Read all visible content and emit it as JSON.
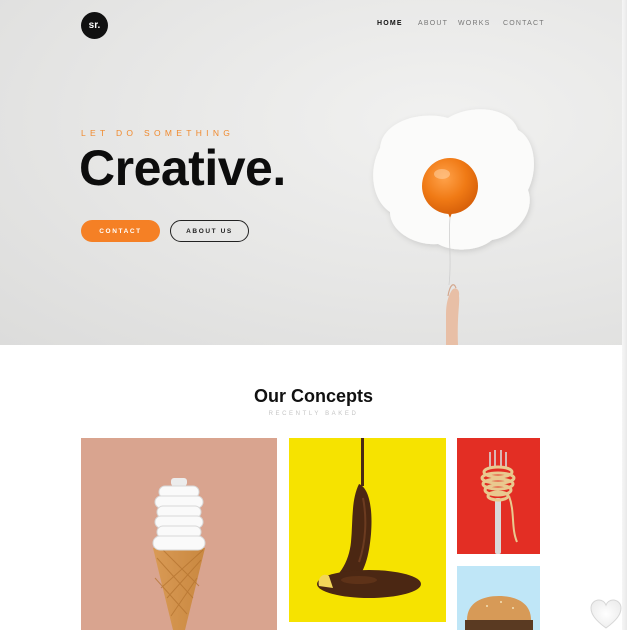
{
  "header": {
    "logo_text": "sr.",
    "nav": [
      {
        "label": "HOME",
        "active": true
      },
      {
        "label": "ABOUT",
        "active": false
      },
      {
        "label": "WORKS",
        "active": false
      },
      {
        "label": "CONTACT",
        "active": false
      }
    ]
  },
  "hero": {
    "eyebrow": "LET DO SOMETHING",
    "headline": "Creative.",
    "buttons": {
      "contact": "CONTACT",
      "about": "ABOUT US"
    },
    "accent_color": "#f58025"
  },
  "concepts": {
    "title": "Our Concepts",
    "subtitle": "RECENTLY BAKED",
    "tiles": [
      {
        "subject": "ice-cream-cone-bulb",
        "bg": "#d9a48f"
      },
      {
        "subject": "chocolate-banana",
        "bg": "#f6e300"
      },
      {
        "subject": "spaghetti-fork",
        "bg": "#e32e24"
      },
      {
        "subject": "burger",
        "bg": "#bfe6f7"
      }
    ]
  },
  "icons": {
    "favorite": "heart-icon"
  }
}
